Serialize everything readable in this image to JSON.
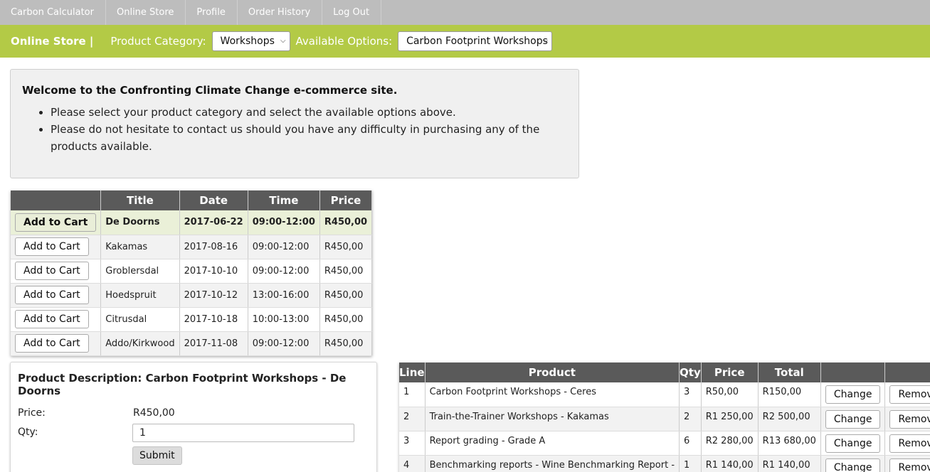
{
  "nav": {
    "items": [
      "Carbon Calculator",
      "Online Store",
      "Profile",
      "Order History",
      "Log Out"
    ]
  },
  "storebar": {
    "title": "Online Store |",
    "category_label": "Product Category:",
    "category_value": "Workshops",
    "options_label": "Available Options:",
    "options_value": "Carbon Footprint Workshops"
  },
  "welcome": {
    "heading": "Welcome to the Confronting Climate Change e-commerce site.",
    "bullets": [
      "Please select your product category and select the available options above.",
      "Please do not hesitate to contact us should you have any difficulty in purchasing any of the products available."
    ]
  },
  "products": {
    "headers": [
      "",
      "Title",
      "Date",
      "Time",
      "Price"
    ],
    "button_label": "Add to Cart",
    "rows": [
      {
        "title": "De Doorns",
        "date": "2017-06-22",
        "time": "09:00-12:00",
        "price": "R450,00"
      },
      {
        "title": "Kakamas",
        "date": "2017-08-16",
        "time": "09:00-12:00",
        "price": "R450,00"
      },
      {
        "title": "Groblersdal",
        "date": "2017-10-10",
        "time": "09:00-12:00",
        "price": "R450,00"
      },
      {
        "title": "Hoedspruit",
        "date": "2017-10-12",
        "time": "13:00-16:00",
        "price": "R450,00"
      },
      {
        "title": "Citrusdal",
        "date": "2017-10-18",
        "time": "10:00-13:00",
        "price": "R450,00"
      },
      {
        "title": "Addo/Kirkwood",
        "date": "2017-11-08",
        "time": "09:00-12:00",
        "price": "R450,00"
      }
    ]
  },
  "description": {
    "label": "Product Description:",
    "product": "Carbon Footprint Workshops - De Doorns",
    "price_label": "Price:",
    "price_value": "R450,00",
    "qty_label": "Qty:",
    "qty_value": "1",
    "submit_label": "Submit"
  },
  "cart": {
    "headers": [
      "Line",
      "Product",
      "Qty",
      "Price",
      "Total",
      "",
      ""
    ],
    "change_label": "Change",
    "remove_label": "Remove",
    "rows": [
      {
        "line": "1",
        "product": "Carbon Footprint Workshops - Ceres",
        "qty": "3",
        "price": "R50,00",
        "total": "R150,00"
      },
      {
        "line": "2",
        "product": "Train-the-Trainer Workshops - Kakamas",
        "qty": "2",
        "price": "R1 250,00",
        "total": "R2 500,00"
      },
      {
        "line": "3",
        "product": "Report grading - Grade A",
        "qty": "6",
        "price": "R2 280,00",
        "total": "R13 680,00"
      },
      {
        "line": "4",
        "product": "Benchmarking reports - Wine Benchmarking Report -",
        "qty": "1",
        "price": "R1 140,00",
        "total": "R1 140,00"
      }
    ]
  }
}
